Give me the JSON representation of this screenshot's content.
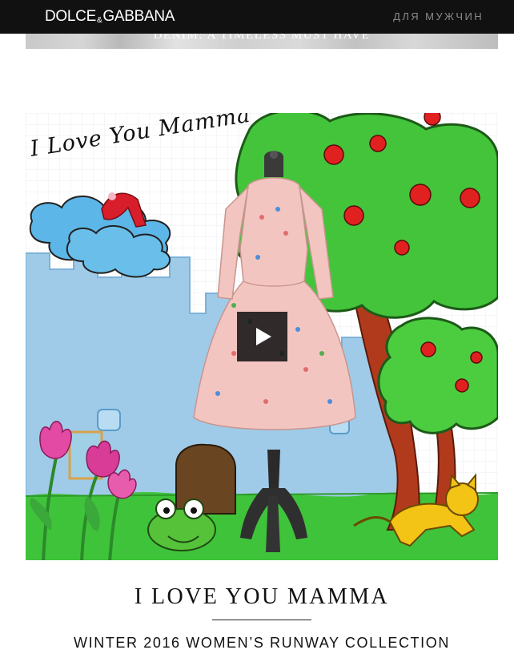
{
  "header": {
    "brand": "DOLCE & GABBANA",
    "brand_left": "DOLCE",
    "brand_amp": "&",
    "brand_right": "GABBANA",
    "nav_men": "ДЛЯ МУЖЧИН"
  },
  "previous_banner": {
    "text": "DENIM: A TIMELESS MUST HAVE"
  },
  "hero": {
    "handwritten_text": "I Love You Mamma",
    "play_icon": "play-icon"
  },
  "feature": {
    "title": "I LOVE YOU MAMMA",
    "subtitle": "WINTER 2016 WOMEN’S RUNWAY COLLECTION"
  },
  "colors": {
    "topbar": "#111111",
    "nav_text": "#8a8a8a",
    "text": "#111111"
  }
}
